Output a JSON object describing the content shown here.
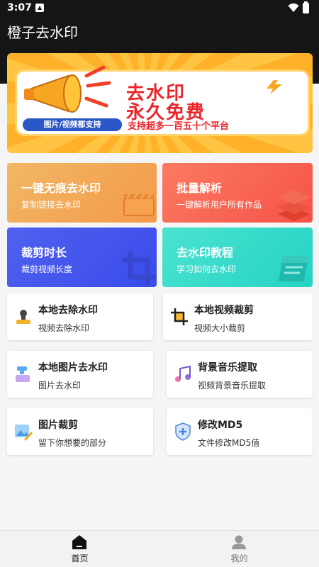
{
  "status": {
    "time": "3:07"
  },
  "app": {
    "title": "橙子去水印"
  },
  "banner": {
    "line1": "去水印",
    "line2": "永久免费",
    "pill": "图片/视频都支持",
    "tagline": "支持超多一百五十个平台"
  },
  "cards": [
    {
      "title": "一键无痕去水印",
      "subtitle": "复制链接去水印",
      "icon": "clapperboard-icon",
      "color": "#f3a454"
    },
    {
      "title": "批量解析",
      "subtitle": "一键解析用户所有作品",
      "icon": "layers-icon",
      "color": "#f86550"
    },
    {
      "title": "裁剪时长",
      "subtitle": "裁剪视频长度",
      "icon": "crop-icon",
      "color": "#4557ec"
    },
    {
      "title": "去水印教程",
      "subtitle": "学习如何去水印",
      "icon": "book-icon",
      "color": "#33dac9"
    }
  ],
  "tools": [
    {
      "title": "本地去除水印",
      "subtitle": "视频去除水印",
      "icon": "stamp-icon"
    },
    {
      "title": "本地视频裁剪",
      "subtitle": "视频大小裁剪",
      "icon": "crop-frame-icon"
    },
    {
      "title": "本地图片去水印",
      "subtitle": "图片去水印",
      "icon": "faucet-icon"
    },
    {
      "title": "背景音乐提取",
      "subtitle": "视频背景音乐提取",
      "icon": "music-note-icon"
    },
    {
      "title": "图片裁剪",
      "subtitle": "留下你想要的部分",
      "icon": "image-edit-icon"
    },
    {
      "title": "修改MD5",
      "subtitle": "文件修改MD5值",
      "icon": "shield-plus-icon"
    }
  ],
  "tabbar": {
    "home": "首页",
    "mine": "我的"
  }
}
